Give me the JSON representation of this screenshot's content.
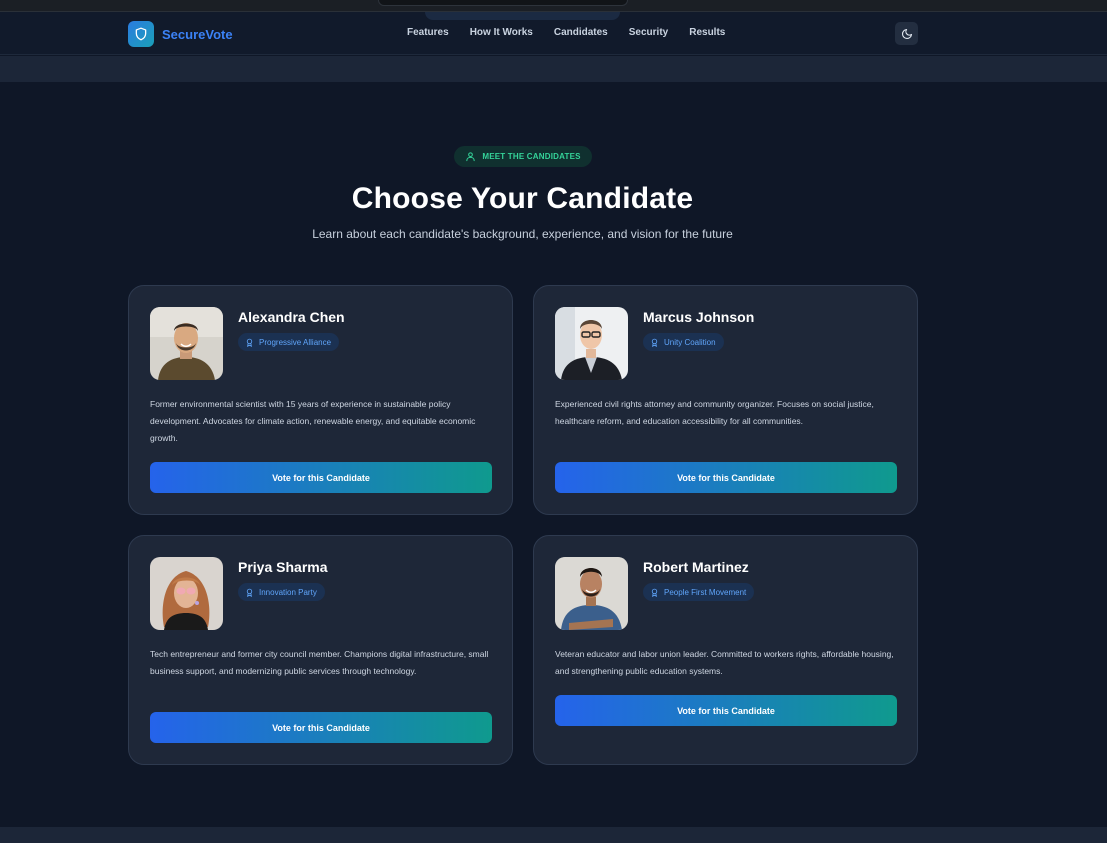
{
  "app": {
    "name": "SecureVote"
  },
  "nav": {
    "links": [
      "Features",
      "How It Works",
      "Candidates",
      "Security",
      "Results"
    ]
  },
  "section": {
    "badge": "MEET THE CANDIDATES",
    "title": "Choose Your Candidate",
    "subtitle": "Learn about each candidate's background, experience, and vision for the future"
  },
  "candidates": [
    {
      "name": "Alexandra Chen",
      "party": "Progressive Alliance",
      "bio": "Former environmental scientist with 15 years of experience in sustainable policy development. Advocates for climate action, renewable energy, and equitable economic growth.",
      "vote_label": "Vote for this Candidate"
    },
    {
      "name": "Marcus Johnson",
      "party": "Unity Coalition",
      "bio": "Experienced civil rights attorney and community organizer. Focuses on social justice, healthcare reform, and education accessibility for all communities.",
      "vote_label": "Vote for this Candidate"
    },
    {
      "name": "Priya Sharma",
      "party": "Innovation Party",
      "bio": "Tech entrepreneur and former city council member. Champions digital infrastructure, small business support, and modernizing public services through technology.",
      "vote_label": "Vote for this Candidate"
    },
    {
      "name": "Robert Martinez",
      "party": "People First Movement",
      "bio": "Veteran educator and labor union leader. Committed to workers rights, affordable housing, and strengthening public education systems.",
      "vote_label": "Vote for this Candidate"
    }
  ],
  "colors": {
    "background": "#0f1727",
    "card": "#1e2738",
    "accent_blue": "#2563eb",
    "accent_teal": "#0f9a8e",
    "badge_green": "#34d399",
    "party_blue": "#60a5fa"
  },
  "icons": {
    "logo": "shield-icon",
    "theme_toggle": "moon-icon",
    "badge": "user-icon",
    "party": "award-icon"
  }
}
